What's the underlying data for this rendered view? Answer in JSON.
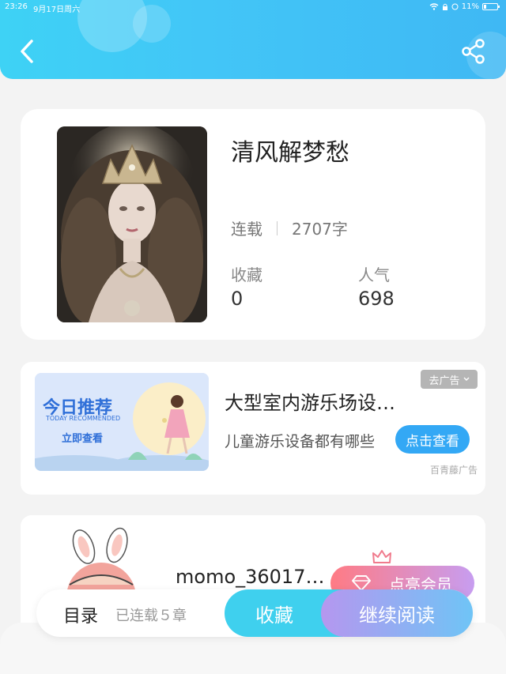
{
  "status_bar": {
    "time": "23:26",
    "date": "9月17日周六",
    "battery": "11%"
  },
  "header": {
    "back_icon": "chevron-left-icon",
    "share_icon": "share-icon",
    "gradient_start": "#3ed2f5",
    "gradient_end": "#3fb8f4"
  },
  "book": {
    "title": "清风解梦愁",
    "status": "连载",
    "word_count": "2707字",
    "favorites_label": "收藏",
    "favorites_value": "0",
    "popularity_label": "人气",
    "popularity_value": "698"
  },
  "ad": {
    "banner_title": "今日推荐",
    "banner_subtitle": "TODAY RECOMMENDED",
    "banner_cta": "立即查看",
    "title": "大型室内游乐场设…",
    "description": "儿童游乐设备都有哪些",
    "button_label": "点击查看",
    "close_label": "去广告",
    "source": "百青藤广告",
    "button_color": "#33a8f5"
  },
  "author": {
    "name": "momo_36017…",
    "vip_label": "点亮会员"
  },
  "bottom_bar": {
    "toc_label": "目录",
    "chapters_label": "已连载５章",
    "collect_label": "收藏",
    "read_label": "继续阅读"
  }
}
